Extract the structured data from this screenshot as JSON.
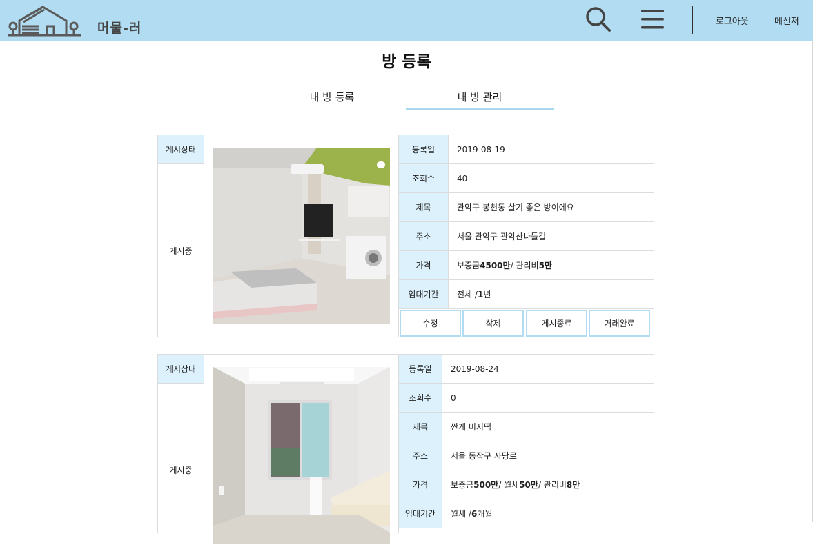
{
  "header": {
    "brand": "머물-러",
    "logout_label": "로그아웃",
    "messenger_label": "메신저",
    "bg_color": "#b2dcf1"
  },
  "page": {
    "title": "방 등록",
    "tabs": [
      {
        "label": "내 방 등록",
        "active": false
      },
      {
        "label": "내 방 관리",
        "active": true
      }
    ]
  },
  "listings": [
    {
      "status_header": "게시상태",
      "status": "게시중",
      "fields": [
        {
          "key": "등록일",
          "value": "2019-08-19"
        },
        {
          "key": "조회수",
          "value": "40"
        },
        {
          "key": "제목",
          "value": "관악구 봉천동 살기 좋은 방이에요"
        },
        {
          "key": "주소",
          "value": "서울 관악구 관악산나들길"
        },
        {
          "key": "가격",
          "parts": {
            "p1": "보증금 ",
            "b1": "4500만",
            "p2": " / 관리비 ",
            "b2": "5만"
          }
        },
        {
          "key": "임대기간",
          "parts": {
            "p1": "전세 / ",
            "b1": "1",
            "p2": " 년"
          }
        }
      ],
      "actions": [
        "수정",
        "삭제",
        "게시종료",
        "거래완료"
      ]
    },
    {
      "status_header": "게시상태",
      "status": "게시중",
      "fields": [
        {
          "key": "등록일",
          "value": "2019-08-24"
        },
        {
          "key": "조회수",
          "value": "0"
        },
        {
          "key": "제목",
          "value": "싼게 비지떡"
        },
        {
          "key": "주소",
          "value": "서울 동작구 사당로"
        },
        {
          "key": "가격",
          "parts": {
            "p1": "보증금 ",
            "b1": "500만",
            "p2": " / 월세 ",
            "b2": "50만",
            "p3": " / 관리비 ",
            "b3": "8만"
          }
        },
        {
          "key": "임대기간",
          "parts": {
            "p1": "월세 / ",
            "b1": "6",
            "p2": " 개월"
          }
        }
      ]
    }
  ]
}
